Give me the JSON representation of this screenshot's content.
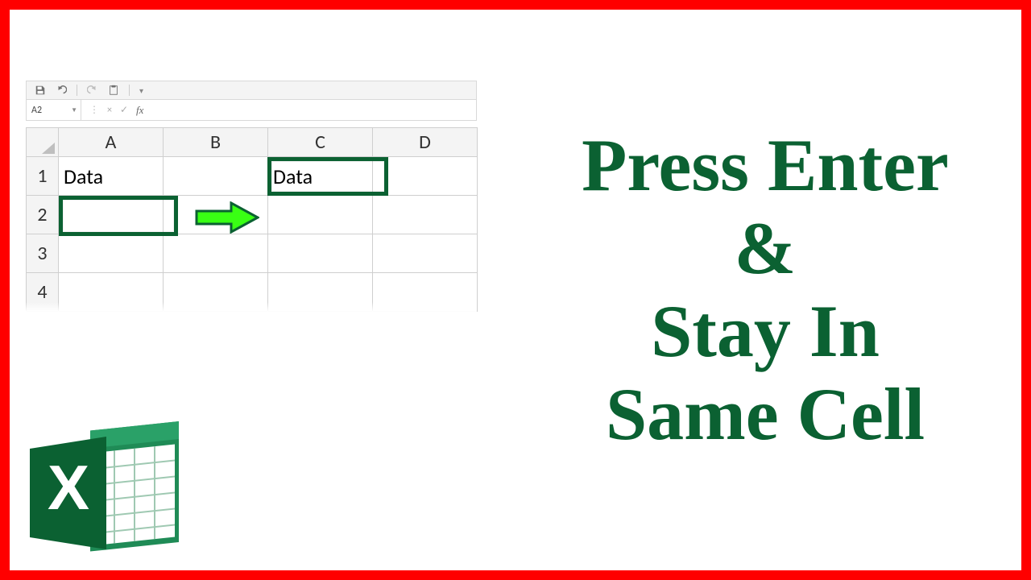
{
  "headline": "Press Enter\n&\nStay In\nSame Cell",
  "qat": {
    "icons": [
      "save-icon",
      "undo-icon",
      "redo-icon",
      "paste-icon",
      "customize-icon"
    ]
  },
  "formula_bar": {
    "name_box": "A2",
    "cancel": "×",
    "confirm": "✓",
    "fx": "fx",
    "formula": ""
  },
  "grid": {
    "columns": [
      "A",
      "B",
      "C",
      "D"
    ],
    "rows": [
      "1",
      "2",
      "3",
      "4"
    ],
    "cells": {
      "A1": "Data",
      "C1": "Data"
    }
  },
  "arrow": {
    "color_fill": "#39ff14",
    "color_stroke": "#0b6132"
  },
  "logo_label": "X"
}
